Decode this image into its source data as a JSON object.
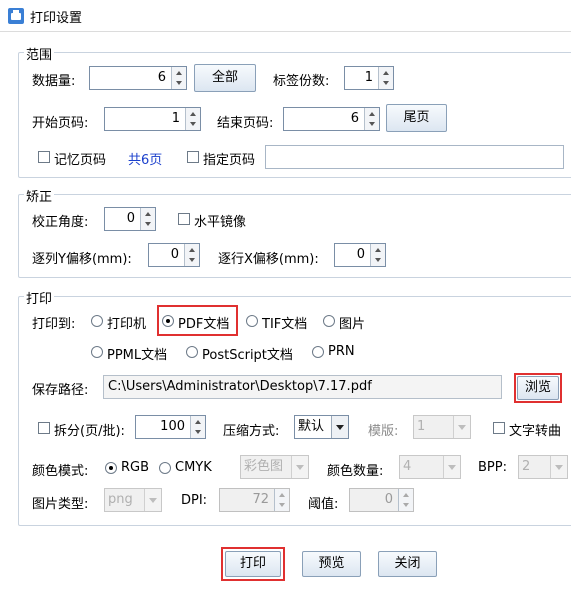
{
  "window": {
    "title": "打印设置"
  },
  "range": {
    "legend": "范围",
    "data_count_label": "数据量:",
    "data_count_value": "6",
    "all_button": "全部",
    "label_copies_label": "标签份数:",
    "label_copies_value": "1",
    "start_page_label": "开始页码:",
    "start_page_value": "1",
    "end_page_label": "结束页码:",
    "end_page_value": "6",
    "last_page_button": "尾页",
    "remember_page_label": "记忆页码",
    "total_pages_text": "共6页",
    "specify_page_label": "指定页码",
    "specify_page_value": ""
  },
  "correction": {
    "legend": "矫正",
    "angle_label": "校正角度:",
    "angle_value": "0",
    "mirror_label": "水平镜像",
    "y_offset_label": "逐列Y偏移(mm):",
    "y_offset_value": "0",
    "x_offset_label": "逐行X偏移(mm):",
    "x_offset_value": "0"
  },
  "print": {
    "legend": "打印",
    "print_to_label": "打印到:",
    "targets": [
      "打印机",
      "PDF文档",
      "TIF文档",
      "图片",
      "PPML文档",
      "PostScript文档",
      "PRN"
    ],
    "selected_target": "PDF文档",
    "save_path_label": "保存路径:",
    "save_path_value": "C:\\Users\\Administrator\\Desktop\\7.17.pdf",
    "browse_button": "浏览",
    "split_label": "拆分(页/批):",
    "split_value": "100",
    "compress_label": "压缩方式:",
    "compress_value": "默认",
    "template_label": "模版:",
    "template_value": "1",
    "text_to_curve_label": "文字转曲",
    "color_mode_label": "颜色模式:",
    "color_modes": [
      "RGB",
      "CMYK"
    ],
    "selected_color_mode": "RGB",
    "color_image_value": "彩色图",
    "color_count_label": "颜色数量:",
    "color_count_value": "4",
    "bpp_label": "BPP:",
    "bpp_value": "2",
    "image_type_label": "图片类型:",
    "image_type_value": "png",
    "dpi_label": "DPI:",
    "dpi_value": "72",
    "threshold_label": "阈值:",
    "threshold_value": "0"
  },
  "footer": {
    "print_button": "打印",
    "preview_button": "预览",
    "close_button": "关闭"
  },
  "colors": {
    "highlight": "#e03030",
    "link": "#1a3fcc"
  }
}
